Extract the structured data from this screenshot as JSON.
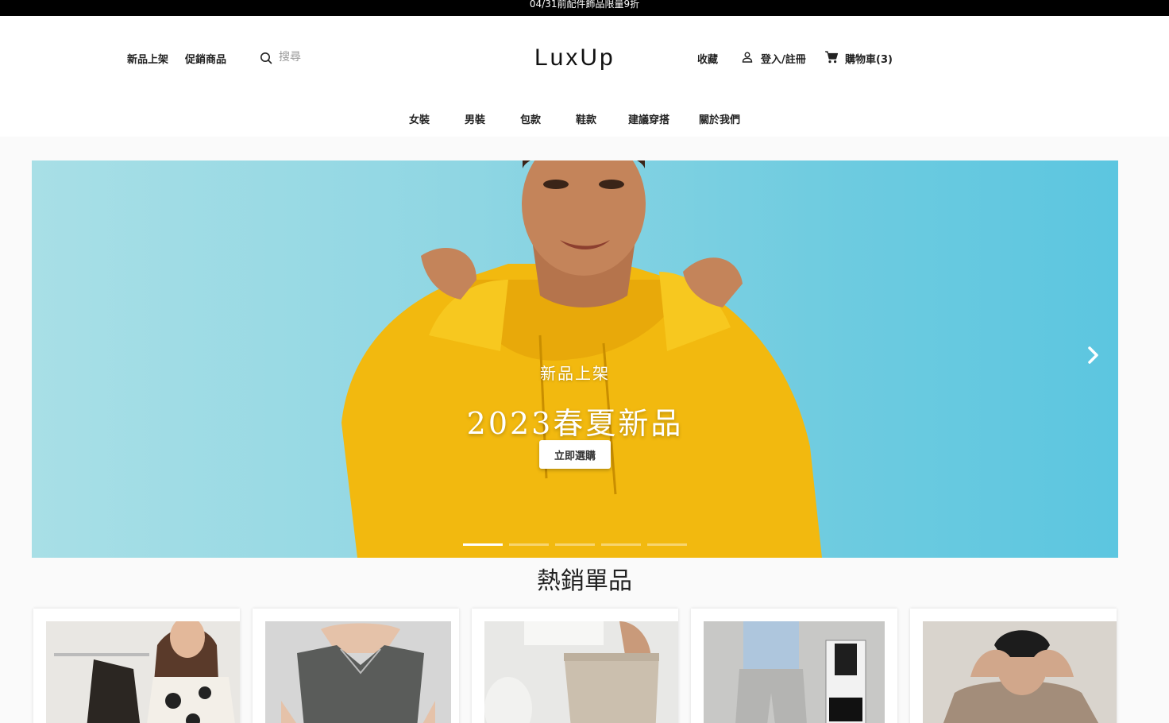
{
  "announcement": "04/31前配件飾品限量9折",
  "header": {
    "nav_new": "新品上架",
    "nav_sale": "促銷商品",
    "search_placeholder": "搜尋",
    "logo": "LuxUp",
    "favorites": "收藏",
    "login": "登入/註冊",
    "cart": "購物車(3)"
  },
  "categories": [
    "女裝",
    "男裝",
    "包款",
    "鞋款",
    "建議穿搭",
    "關於我們"
  ],
  "hero": {
    "subtitle": "新品上架",
    "title": "2023春夏新品",
    "button": "立即選購",
    "slide_count": 5,
    "active_slide": 1
  },
  "bestsellers": {
    "title": "熱銷單品",
    "products": [
      {
        "image": "floral-camisole-photo"
      },
      {
        "image": "gray-square-neck-top-photo"
      },
      {
        "image": "beige-pants-photo"
      },
      {
        "image": "gray-shorts-photo"
      },
      {
        "image": "beige-tshirt-photo"
      }
    ]
  },
  "colors": {
    "topbar_bg": "#000000",
    "hero_sky": "#6dcbe0",
    "hoodie": "#f2b90f"
  }
}
